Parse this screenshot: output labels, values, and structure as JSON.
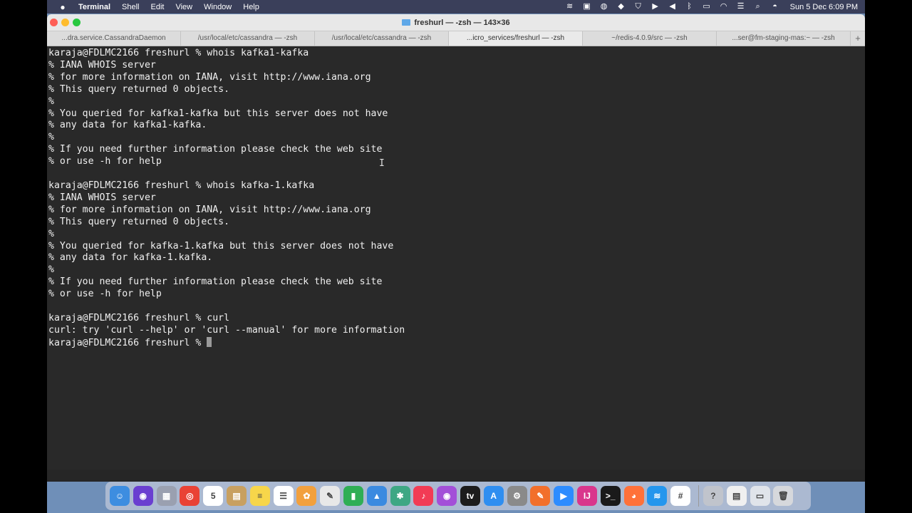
{
  "menubar": {
    "apple": "",
    "app_name": "Terminal",
    "menus": [
      "Shell",
      "Edit",
      "View",
      "Window",
      "Help"
    ],
    "clock": "Sun 5 Dec  6:09 PM"
  },
  "window": {
    "title": "freshurl — -zsh — 143×36",
    "tabs": [
      {
        "label": "...dra.service.CassandraDaemon"
      },
      {
        "label": "/usr/local/etc/cassandra — -zsh"
      },
      {
        "label": "/usr/local/etc/cassandra — -zsh"
      },
      {
        "label": "...icro_services/freshurl — -zsh"
      },
      {
        "label": "~/redis-4.0.9/src — -zsh"
      },
      {
        "label": "...ser@fm-staging-mas:~ — -zsh"
      }
    ],
    "add_tab": "+"
  },
  "terminal": {
    "lines": [
      "karaja@FDLMC2166 freshurl % whois kafka1-kafka",
      "% IANA WHOIS server",
      "% for more information on IANA, visit http://www.iana.org",
      "% This query returned 0 objects.",
      "%",
      "% You queried for kafka1-kafka but this server does not have",
      "% any data for kafka1-kafka.",
      "%",
      "% If you need further information please check the web site",
      "% or use -h for help",
      "",
      "karaja@FDLMC2166 freshurl % whois kafka-1.kafka",
      "% IANA WHOIS server",
      "% for more information on IANA, visit http://www.iana.org",
      "% This query returned 0 objects.",
      "%",
      "% You queried for kafka-1.kafka but this server does not have",
      "% any data for kafka-1.kafka.",
      "%",
      "% If you need further information please check the web site",
      "% or use -h for help",
      "",
      "karaja@FDLMC2166 freshurl % curl",
      "curl: try 'curl --help' or 'curl --manual' for more information"
    ],
    "prompt": "karaja@FDLMC2166 freshurl % "
  },
  "dock": {
    "items": [
      {
        "name": "finder-icon",
        "color": "#3d8de0",
        "glyph": "☺"
      },
      {
        "name": "siri-icon",
        "color": "#6a3fd0",
        "glyph": "◉"
      },
      {
        "name": "launchpad-icon",
        "color": "#9aa0b0",
        "glyph": "▦"
      },
      {
        "name": "chrome-icon",
        "color": "#e94235",
        "glyph": "◎"
      },
      {
        "name": "calendar-icon",
        "color": "#ffffff",
        "glyph": "5"
      },
      {
        "name": "contacts-icon",
        "color": "#c8a060",
        "glyph": "▤"
      },
      {
        "name": "notes-icon",
        "color": "#f7d64a",
        "glyph": "≡"
      },
      {
        "name": "reminders-icon",
        "color": "#ffffff",
        "glyph": "☰"
      },
      {
        "name": "photos-icon",
        "color": "#f2a03d",
        "glyph": "✿"
      },
      {
        "name": "textedit-icon",
        "color": "#e8e8e8",
        "glyph": "✎"
      },
      {
        "name": "numbers-icon",
        "color": "#2fae55",
        "glyph": "▮"
      },
      {
        "name": "keynote-icon",
        "color": "#3b8ae0",
        "glyph": "▲"
      },
      {
        "name": "chatgpt-icon",
        "color": "#3ea784",
        "glyph": "✱"
      },
      {
        "name": "music-icon",
        "color": "#f23b55",
        "glyph": "♪"
      },
      {
        "name": "podcasts-icon",
        "color": "#a34fd8",
        "glyph": "◉"
      },
      {
        "name": "appletv-icon",
        "color": "#1c1c1c",
        "glyph": "tv"
      },
      {
        "name": "appstore-icon",
        "color": "#2f8ef0",
        "glyph": "A"
      },
      {
        "name": "system-preferences-icon",
        "color": "#8a8a8a",
        "glyph": "⚙"
      },
      {
        "name": "sketch-icon",
        "color": "#f26f2b",
        "glyph": "✎"
      },
      {
        "name": "zoom-icon",
        "color": "#2d8cff",
        "glyph": "▶"
      },
      {
        "name": "intellij-icon",
        "color": "#d9368c",
        "glyph": "IJ"
      },
      {
        "name": "terminal-icon",
        "color": "#1a1a1a",
        "glyph": ">_"
      },
      {
        "name": "firefox-icon",
        "color": "#ff7139",
        "glyph": "◕"
      },
      {
        "name": "docker-icon",
        "color": "#2496ed",
        "glyph": "≋"
      },
      {
        "name": "slack-icon",
        "color": "#ffffff",
        "glyph": "#"
      },
      {
        "name": "help-icon",
        "color": "#c0c4cc",
        "glyph": "?"
      },
      {
        "name": "document-icon",
        "color": "#f0f0f0",
        "glyph": "▤"
      },
      {
        "name": "screen-icon",
        "color": "#e0e4ea",
        "glyph": "▭"
      },
      {
        "name": "trash-icon",
        "color": "#d6d8dc",
        "glyph": "🗑"
      }
    ]
  },
  "colors": {
    "terminal_bg": "#292929",
    "terminal_fg": "#f0f0f0",
    "menubar_bg": "#3a3f5a"
  }
}
